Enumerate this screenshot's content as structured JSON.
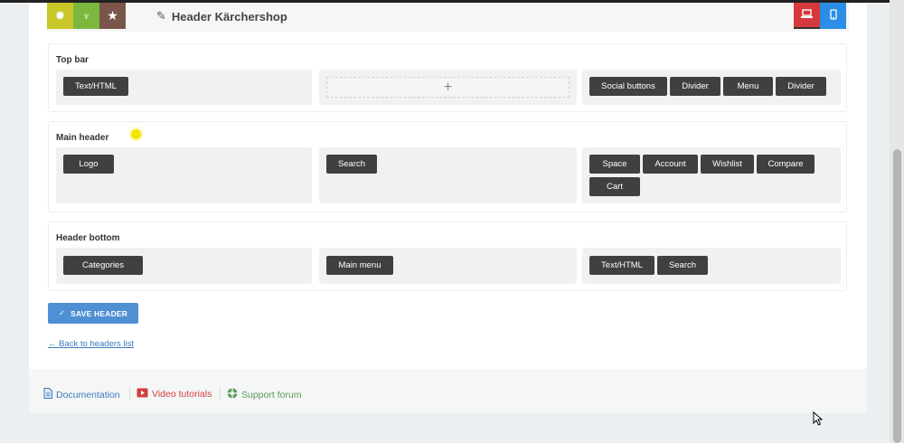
{
  "header": {
    "title": "Header Kärchershop",
    "colors": {
      "settings": "#c7c72a",
      "marker": "#7cb83e",
      "star": "#79554a",
      "desktop": "#d6393d",
      "mobile": "#2a8ee6"
    }
  },
  "sections": {
    "top_bar": {
      "title": "Top bar",
      "left": [
        "Text/HTML"
      ],
      "center_add": "+",
      "right": [
        "Social buttons",
        "Divider",
        "Menu",
        "Divider"
      ]
    },
    "main_header": {
      "title": "Main header",
      "left": [
        "Logo"
      ],
      "center": [
        "Search"
      ],
      "right": [
        "Space",
        "Account",
        "Wishlist",
        "Compare",
        "Cart"
      ]
    },
    "header_bottom": {
      "title": "Header bottom",
      "left": [
        "Categories"
      ],
      "center": [
        "Main menu"
      ],
      "right": [
        "Text/HTML",
        "Search"
      ]
    }
  },
  "actions": {
    "save_label": "SAVE HEADER",
    "save_check": "✓",
    "back_label": "← Back to headers list"
  },
  "footer": {
    "documentation": "Documentation",
    "video_tutorials": "Video tutorials",
    "support_forum": "Support forum"
  }
}
